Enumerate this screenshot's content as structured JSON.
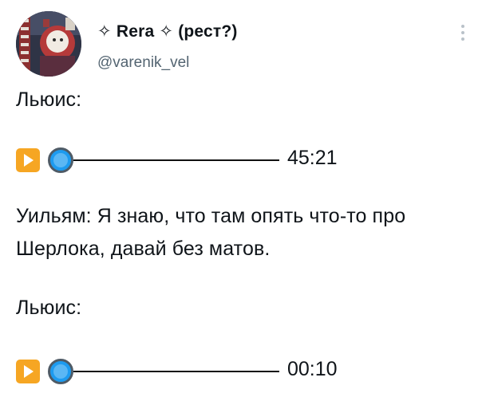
{
  "author": {
    "display_name": "✧ Rera ✧ (рест?)",
    "handle": "@varenik_vel"
  },
  "body": {
    "line1": "Льюис:",
    "player1": {
      "time": "45:21"
    },
    "line2": "Уильям: Я знаю, что там опять что-то про",
    "line3": "Шерлока, давай без матов.",
    "line4": "Льюис:",
    "player2": {
      "time": "00:10"
    }
  },
  "icons": {
    "play": "play-icon",
    "knob": "audio-progress-knob",
    "more": "more-options-icon"
  },
  "colors": {
    "play_button": "#f6a623",
    "knob": "#1d9bf0",
    "handle_text": "#536471"
  }
}
